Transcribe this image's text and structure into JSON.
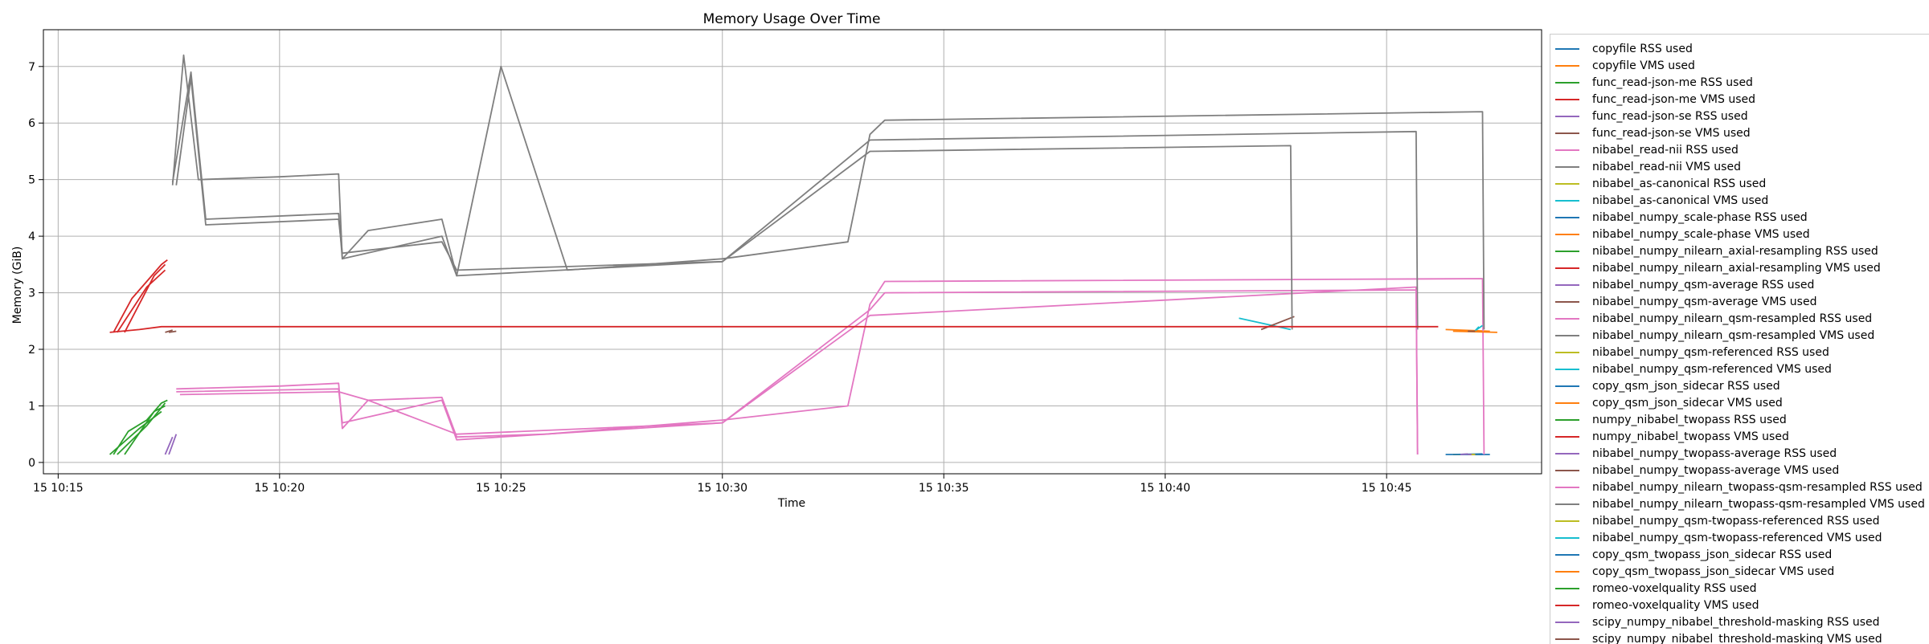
{
  "chart_data": {
    "type": "line",
    "title": "Memory Usage Over Time",
    "xlabel": "Time",
    "ylabel": "Memory (GiB)",
    "xlim": [
      "15 10:14:40",
      "15 10:48:30"
    ],
    "ylim": [
      -0.2,
      7.65
    ],
    "x_ticks": [
      {
        "t": "15 10:15:00",
        "label": "15 10:15"
      },
      {
        "t": "15 10:20:00",
        "label": "15 10:20"
      },
      {
        "t": "15 10:25:00",
        "label": "15 10:25"
      },
      {
        "t": "15 10:30:00",
        "label": "15 10:30"
      },
      {
        "t": "15 10:35:00",
        "label": "15 10:35"
      },
      {
        "t": "15 10:40:00",
        "label": "15 10:40"
      },
      {
        "t": "15 10:45:00",
        "label": "15 10:45"
      }
    ],
    "y_ticks": [
      0,
      1,
      2,
      3,
      4,
      5,
      6,
      7
    ],
    "grid": true,
    "legend_position": "outside-right",
    "series": [
      {
        "name": "copyfile RSS used",
        "color": "#1f77b4",
        "points": [
          [
            "15 10:46:20",
            0.14
          ],
          [
            "15 10:47:00",
            0.14
          ],
          [
            "15 10:47:20",
            0.14
          ]
        ]
      },
      {
        "name": "copyfile VMS used",
        "color": "#ff7f0e",
        "points": [
          [
            "15 10:46:20",
            2.35
          ],
          [
            "15 10:47:00",
            2.33
          ],
          [
            "15 10:47:20",
            2.32
          ]
        ]
      },
      {
        "name": "func_read-json-me RSS used",
        "color": "#2ca02c",
        "points": [
          [
            "15 10:16:15",
            0.14
          ],
          [
            "15 10:16:35",
            0.55
          ],
          [
            "15 10:17:00",
            0.75
          ],
          [
            "15 10:17:20",
            1.05
          ],
          [
            "15 10:17:28",
            1.1
          ]
        ]
      },
      {
        "name": "func_read-json-me VMS used",
        "color": "#d62728",
        "points": [
          [
            "15 10:16:15",
            2.3
          ],
          [
            "15 10:16:40",
            2.9
          ],
          [
            "15 10:17:00",
            3.2
          ],
          [
            "15 10:17:20",
            3.5
          ],
          [
            "15 10:17:28",
            3.58
          ]
        ]
      },
      {
        "name": "func_read-json-se RSS used",
        "color": "#9467bd",
        "points": [
          [
            "15 10:17:25",
            0.14
          ],
          [
            "15 10:17:35",
            0.45
          ]
        ]
      },
      {
        "name": "func_read-json-se VMS used",
        "color": "#8c564b",
        "points": [
          [
            "15 10:17:25",
            2.3
          ],
          [
            "15 10:17:35",
            2.34
          ]
        ]
      },
      {
        "name": "nibabel_read-nii RSS used",
        "color": "#e377c2",
        "points": [
          [
            "15 10:17:40",
            1.3
          ],
          [
            "15 10:20:00",
            1.35
          ],
          [
            "15 10:21:20",
            1.4
          ],
          [
            "15 10:21:25",
            0.6
          ],
          [
            "15 10:22:00",
            1.1
          ],
          [
            "15 10:23:40",
            1.15
          ],
          [
            "15 10:24:00",
            0.45
          ],
          [
            "15 10:26:00",
            0.5
          ],
          [
            "15 10:30:00",
            0.75
          ],
          [
            "15 10:32:50",
            1.0
          ],
          [
            "15 10:33:20",
            2.8
          ],
          [
            "15 10:33:40",
            3.2
          ],
          [
            "15 10:47:10",
            3.25
          ],
          [
            "15 10:47:12",
            0.14
          ]
        ]
      },
      {
        "name": "nibabel_read-nii VMS used",
        "color": "#7f7f7f",
        "points": [
          [
            "15 10:17:35",
            4.9
          ],
          [
            "15 10:17:50",
            7.2
          ],
          [
            "15 10:18:10",
            5.0
          ],
          [
            "15 10:20:00",
            5.05
          ],
          [
            "15 10:21:20",
            5.1
          ],
          [
            "15 10:21:25",
            3.6
          ],
          [
            "15 10:22:00",
            4.1
          ],
          [
            "15 10:23:40",
            4.3
          ],
          [
            "15 10:24:00",
            3.3
          ],
          [
            "15 10:25:00",
            7.0
          ],
          [
            "15 10:26:30",
            3.4
          ],
          [
            "15 10:30:00",
            3.6
          ],
          [
            "15 10:32:50",
            3.9
          ],
          [
            "15 10:33:20",
            5.8
          ],
          [
            "15 10:33:40",
            6.05
          ],
          [
            "15 10:47:10",
            6.2
          ],
          [
            "15 10:47:12",
            2.35
          ]
        ]
      },
      {
        "name": "nibabel_as-canonical RSS used",
        "color": "#bcbd22",
        "points": [
          [
            "15 10:46:30",
            0.14
          ],
          [
            "15 10:46:40",
            0.14
          ]
        ]
      },
      {
        "name": "nibabel_as-canonical VMS used",
        "color": "#17becf",
        "points": [
          [
            "15 10:41:40",
            2.55
          ],
          [
            "15 10:42:50",
            2.35
          ]
        ]
      },
      {
        "name": "nibabel_numpy_scale-phase RSS used",
        "color": "#1f77b4",
        "points": [
          [
            "15 10:46:30",
            0.14
          ],
          [
            "15 10:47:10",
            0.15
          ]
        ]
      },
      {
        "name": "nibabel_numpy_scale-phase VMS used",
        "color": "#ff7f0e",
        "points": [
          [
            "15 10:46:30",
            2.32
          ],
          [
            "15 10:47:30",
            2.3
          ]
        ]
      },
      {
        "name": "nibabel_numpy_nilearn_axial-resampling RSS used",
        "color": "#2ca02c",
        "points": [
          [
            "15 10:16:20",
            0.14
          ],
          [
            "15 10:17:00",
            0.65
          ],
          [
            "15 10:17:25",
            1.05
          ]
        ]
      },
      {
        "name": "nibabel_numpy_nilearn_axial-resampling VMS used",
        "color": "#d62728",
        "points": [
          [
            "15 10:16:20",
            2.3
          ],
          [
            "15 10:17:00",
            3.1
          ],
          [
            "15 10:17:25",
            3.4
          ]
        ]
      },
      {
        "name": "nibabel_numpy_qsm-average RSS used",
        "color": "#9467bd",
        "points": [
          [
            "15 10:46:40",
            0.14
          ],
          [
            "15 10:46:50",
            0.15
          ]
        ]
      },
      {
        "name": "nibabel_numpy_qsm-average VMS used",
        "color": "#8c564b",
        "points": [
          [
            "15 10:42:10",
            2.35
          ],
          [
            "15 10:42:55",
            2.58
          ]
        ]
      },
      {
        "name": "nibabel_numpy_nilearn_qsm-resampled RSS used",
        "color": "#e377c2",
        "points": [
          [
            "15 10:17:40",
            1.25
          ],
          [
            "15 10:21:20",
            1.3
          ],
          [
            "15 10:21:25",
            0.7
          ],
          [
            "15 10:23:40",
            1.1
          ],
          [
            "15 10:24:00",
            0.4
          ],
          [
            "15 10:30:00",
            0.7
          ],
          [
            "15 10:33:20",
            2.6
          ],
          [
            "15 10:45:40",
            3.1
          ],
          [
            "15 10:45:42",
            0.14
          ]
        ]
      },
      {
        "name": "nibabel_numpy_nilearn_qsm-resampled VMS used",
        "color": "#7f7f7f",
        "points": [
          [
            "15 10:17:35",
            4.95
          ],
          [
            "15 10:18:00",
            6.9
          ],
          [
            "15 10:18:20",
            4.3
          ],
          [
            "15 10:21:20",
            4.4
          ],
          [
            "15 10:21:25",
            3.6
          ],
          [
            "15 10:23:40",
            4.0
          ],
          [
            "15 10:24:00",
            3.3
          ],
          [
            "15 10:30:00",
            3.55
          ],
          [
            "15 10:33:20",
            5.7
          ],
          [
            "15 10:45:40",
            5.85
          ],
          [
            "15 10:45:42",
            2.35
          ]
        ]
      },
      {
        "name": "nibabel_numpy_qsm-referenced RSS used",
        "color": "#bcbd22",
        "points": [
          [
            "15 10:46:50",
            0.14
          ],
          [
            "15 10:47:00",
            0.14
          ]
        ]
      },
      {
        "name": "nibabel_numpy_qsm-referenced VMS used",
        "color": "#17becf",
        "points": [
          [
            "15 10:47:00",
            2.33
          ],
          [
            "15 10:47:05",
            2.4
          ]
        ]
      },
      {
        "name": "copy_qsm_json_sidecar RSS used",
        "color": "#1f77b4",
        "points": [
          [
            "15 10:46:50",
            0.14
          ],
          [
            "15 10:47:00",
            0.14
          ]
        ]
      },
      {
        "name": "copy_qsm_json_sidecar VMS used",
        "color": "#ff7f0e",
        "points": [
          [
            "15 10:46:50",
            2.32
          ],
          [
            "15 10:47:00",
            2.32
          ]
        ]
      },
      {
        "name": "numpy_nibabel_twopass RSS used",
        "color": "#2ca02c",
        "points": [
          [
            "15 10:16:30",
            0.14
          ],
          [
            "15 10:17:10",
            0.9
          ],
          [
            "15 10:17:25",
            1.0
          ]
        ]
      },
      {
        "name": "numpy_nibabel_twopass VMS used",
        "color": "#d62728",
        "points": [
          [
            "15 10:16:30",
            2.3
          ],
          [
            "15 10:17:10",
            3.3
          ],
          [
            "15 10:17:25",
            3.5
          ]
        ]
      },
      {
        "name": "nibabel_numpy_twopass-average RSS used",
        "color": "#9467bd",
        "points": [
          [
            "15 10:46:50",
            0.14
          ],
          [
            "15 10:47:00",
            0.14
          ]
        ]
      },
      {
        "name": "nibabel_numpy_twopass-average VMS used",
        "color": "#8c564b",
        "points": [
          [
            "15 10:46:50",
            2.32
          ],
          [
            "15 10:47:00",
            2.32
          ]
        ]
      },
      {
        "name": "nibabel_numpy_nilearn_twopass-qsm-resampled RSS used",
        "color": "#e377c2",
        "points": [
          [
            "15 10:17:45",
            1.2
          ],
          [
            "15 10:21:20",
            1.25
          ],
          [
            "15 10:22:00",
            1.1
          ],
          [
            "15 10:24:00",
            0.5
          ],
          [
            "15 10:30:00",
            0.7
          ],
          [
            "15 10:33:20",
            2.7
          ],
          [
            "15 10:33:40",
            3.0
          ],
          [
            "15 10:45:40",
            3.05
          ],
          [
            "15 10:45:42",
            0.14
          ]
        ]
      },
      {
        "name": "nibabel_numpy_nilearn_twopass-qsm-resampled VMS used",
        "color": "#7f7f7f",
        "points": [
          [
            "15 10:17:40",
            4.9
          ],
          [
            "15 10:18:00",
            6.8
          ],
          [
            "15 10:18:20",
            4.2
          ],
          [
            "15 10:21:20",
            4.3
          ],
          [
            "15 10:21:25",
            3.7
          ],
          [
            "15 10:23:40",
            3.9
          ],
          [
            "15 10:24:00",
            3.4
          ],
          [
            "15 10:30:00",
            3.55
          ],
          [
            "15 10:33:20",
            5.5
          ],
          [
            "15 10:42:50",
            5.6
          ],
          [
            "15 10:42:52",
            2.35
          ]
        ]
      },
      {
        "name": "nibabel_numpy_qsm-twopass-referenced RSS used",
        "color": "#bcbd22",
        "points": [
          [
            "15 10:46:55",
            0.14
          ],
          [
            "15 10:47:05",
            0.14
          ]
        ]
      },
      {
        "name": "nibabel_numpy_qsm-twopass-referenced VMS used",
        "color": "#17becf",
        "points": [
          [
            "15 10:47:00",
            2.33
          ],
          [
            "15 10:47:10",
            2.42
          ]
        ]
      },
      {
        "name": "copy_qsm_twopass_json_sidecar RSS used",
        "color": "#1f77b4",
        "points": [
          [
            "15 10:47:00",
            0.14
          ],
          [
            "15 10:47:10",
            0.14
          ]
        ]
      },
      {
        "name": "copy_qsm_twopass_json_sidecar VMS used",
        "color": "#ff7f0e",
        "points": [
          [
            "15 10:47:00",
            2.32
          ],
          [
            "15 10:47:10",
            2.32
          ]
        ]
      },
      {
        "name": "romeo-voxelquality RSS used",
        "color": "#2ca02c",
        "points": [
          [
            "15 10:16:10",
            0.14
          ],
          [
            "15 10:16:50",
            0.6
          ],
          [
            "15 10:17:20",
            0.9
          ]
        ]
      },
      {
        "name": "romeo-voxelquality VMS used",
        "color": "#d62728",
        "points": [
          [
            "15 10:16:10",
            2.3
          ],
          [
            "15 10:16:50",
            2.35
          ],
          [
            "15 10:17:20",
            2.4
          ],
          [
            "15 10:46:10",
            2.4
          ]
        ]
      },
      {
        "name": "scipy_numpy_nibabel_threshold-masking RSS used",
        "color": "#9467bd",
        "points": [
          [
            "15 10:17:30",
            0.14
          ],
          [
            "15 10:17:40",
            0.5
          ]
        ]
      },
      {
        "name": "scipy_numpy_nibabel_threshold-masking VMS used",
        "color": "#8c564b",
        "points": [
          [
            "15 10:17:30",
            2.3
          ],
          [
            "15 10:17:40",
            2.32
          ]
        ]
      }
    ]
  }
}
